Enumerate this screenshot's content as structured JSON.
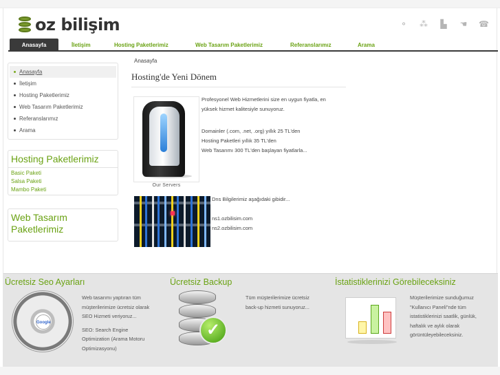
{
  "logo": {
    "text": "oz bilişim"
  },
  "header_icons": [
    "sitemap-dots-icon",
    "network-icon",
    "building-icon",
    "hand-icon",
    "phone-icon"
  ],
  "nav": {
    "items": [
      "Anasayfa",
      "İletişim",
      "Hosting Paketlerimiz",
      "Web Tasarım Paketlerimiz",
      "Referanslarımız",
      "Arama"
    ],
    "active_index": 0
  },
  "sidebar": {
    "menu": [
      "Anasayfa",
      "İletişim",
      "Hosting Paketlerimiz",
      "Web Tasarım Paketlerimiz",
      "Referanslarımız",
      "Arama"
    ],
    "hosting_box": {
      "title": "Hosting Paketlerimiz",
      "links": [
        "Basic Paketi",
        "Salsa Paketi",
        "Mambo Paketi"
      ]
    },
    "web_box": {
      "title": "Web Tasarım Paketlerimiz"
    }
  },
  "main": {
    "breadcrumb": "Anasayfa",
    "title": "Hosting'de Yeni Dönem",
    "image_caption": "Our Servers",
    "intro_lines": [
      "Profesyonel Web Hizmetlerini size en uygun fiyatla, en",
      "yüksek hizmet kalitesiyle sunuyoruz."
    ],
    "price_lines": [
      "Domainler (.com, .net, .org) yıllık 25 TL'den",
      "Hosting Paketleri yıllık 35 TL'den",
      "Web Tasarımı 300 TL'den başlayan fiyatlarla..."
    ],
    "dns_lines": [
      "Dns Bilgilerimiz aşağıdaki gibidir...",
      "",
      "ns1.ozbilisim.com",
      "ns2.ozbilisim.com"
    ]
  },
  "footer": {
    "seo": {
      "title": "Ücretsiz Seo Ayarları",
      "lines": [
        "Web tasarımı yaptıran tüm",
        "müşterilerimize ücretsiz olarak",
        "SEO Hizmeti veriyoruz...",
        "",
        "SEO: Search Engine",
        "Optimization (Arama Motoru",
        "Optimizasyonu)"
      ],
      "wheel_label": "Google"
    },
    "backup": {
      "title": "Ücretsiz Backup",
      "lines": [
        "Tüm müşterilerimize ücretsiz",
        "back-up hizmeti sunuyoruz..."
      ]
    },
    "stats": {
      "title": "İstatistiklerinizi Görebileceksiniz",
      "lines": [
        "Müşterilerimize sunduğumuz",
        "\"Kullanıcı Paneli\"nde tüm",
        "istatistiklerinizi saatlik, günlük,",
        "haftalık ve aylık olarak",
        "görüntüleyebileceksiniz."
      ]
    }
  },
  "colors": {
    "accent": "#6aa213",
    "nav_active_bg": "#3a3a3a",
    "footer_bg": "#e5e5e5"
  }
}
